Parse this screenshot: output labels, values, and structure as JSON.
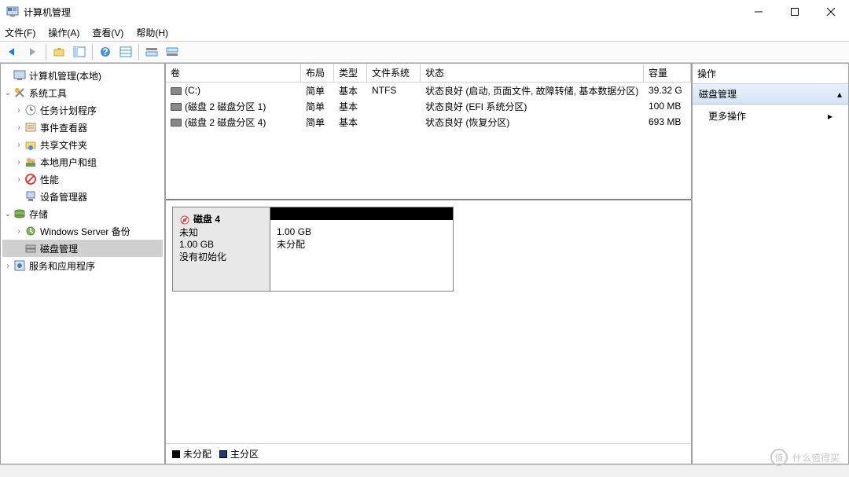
{
  "window": {
    "title": "计算机管理"
  },
  "menus": {
    "file": "文件(F)",
    "action": "操作(A)",
    "view": "查看(V)",
    "help": "帮助(H)"
  },
  "tree": {
    "root": "计算机管理(本地)",
    "sys_tools": "系统工具",
    "task_scheduler": "任务计划程序",
    "event_viewer": "事件查看器",
    "shared_folders": "共享文件夹",
    "local_users": "本地用户和组",
    "performance": "性能",
    "device_manager": "设备管理器",
    "storage": "存储",
    "ws_backup": "Windows Server 备份",
    "disk_mgmt": "磁盘管理",
    "services_apps": "服务和应用程序"
  },
  "columns": {
    "volume": "卷",
    "layout": "布局",
    "type": "类型",
    "fs": "文件系统",
    "status": "状态",
    "capacity": "容量"
  },
  "volumes": [
    {
      "name": "(C:)",
      "layout": "简单",
      "type": "基本",
      "fs": "NTFS",
      "status": "状态良好 (启动, 页面文件, 故障转储, 基本数据分区)",
      "capacity": "39.32 G"
    },
    {
      "name": "(磁盘 2 磁盘分区 1)",
      "layout": "简单",
      "type": "基本",
      "fs": "",
      "status": "状态良好 (EFI 系统分区)",
      "capacity": "100 MB"
    },
    {
      "name": "(磁盘 2 磁盘分区 4)",
      "layout": "简单",
      "type": "基本",
      "fs": "",
      "status": "状态良好 (恢复分区)",
      "capacity": "693 MB"
    }
  ],
  "disk": {
    "name": "磁盘 4",
    "status": "未知",
    "size": "1.00 GB",
    "init": "没有初始化",
    "part_size": "1.00 GB",
    "part_status": "未分配"
  },
  "legend": {
    "unalloc": "未分配",
    "primary": "主分区"
  },
  "actions": {
    "header": "操作",
    "disk_mgmt": "磁盘管理",
    "more": "更多操作"
  },
  "watermark": {
    "brand": "什么值得买",
    "mark": "值"
  }
}
